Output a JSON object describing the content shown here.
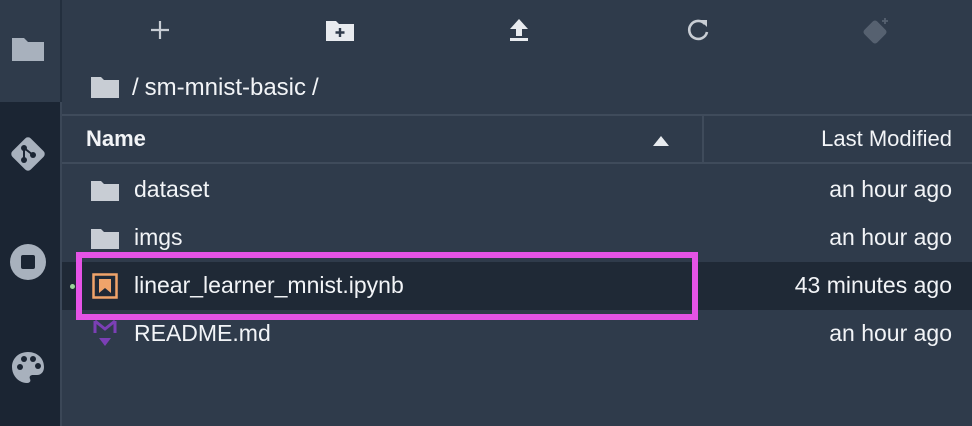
{
  "activity_bar": {
    "items": [
      {
        "icon": "folder-icon"
      },
      {
        "icon": "git-icon"
      },
      {
        "icon": "stop-circle-icon"
      },
      {
        "icon": "palette-icon"
      }
    ]
  },
  "toolbar": {
    "buttons": [
      {
        "icon": "plus-icon"
      },
      {
        "icon": "new-folder-icon"
      },
      {
        "icon": "upload-icon"
      },
      {
        "icon": "refresh-icon"
      },
      {
        "icon": "git-clone-icon"
      }
    ]
  },
  "breadcrumbs": {
    "root_sep": "/",
    "folder": "sm-mnist-basic",
    "trail_sep": "/"
  },
  "file_list": {
    "columns": {
      "name": "Name",
      "modified": "Last Modified"
    },
    "rows": [
      {
        "icon": "folder-icon",
        "name": "dataset",
        "modified": "an hour ago"
      },
      {
        "icon": "folder-icon",
        "name": "imgs",
        "modified": "an hour ago"
      },
      {
        "icon": "notebook-icon",
        "name": "linear_learner_mnist.ipynb",
        "modified": "43 minutes ago",
        "selected": true
      },
      {
        "icon": "markdown-icon",
        "name": "README.md",
        "modified": "an hour ago"
      }
    ]
  },
  "colors": {
    "background": "#2f3b4b",
    "sidebar": "#1b2533",
    "highlight": "#e553e6",
    "notebook_icon": "#f0a46a",
    "markdown_icon": "#7b3fb5"
  }
}
